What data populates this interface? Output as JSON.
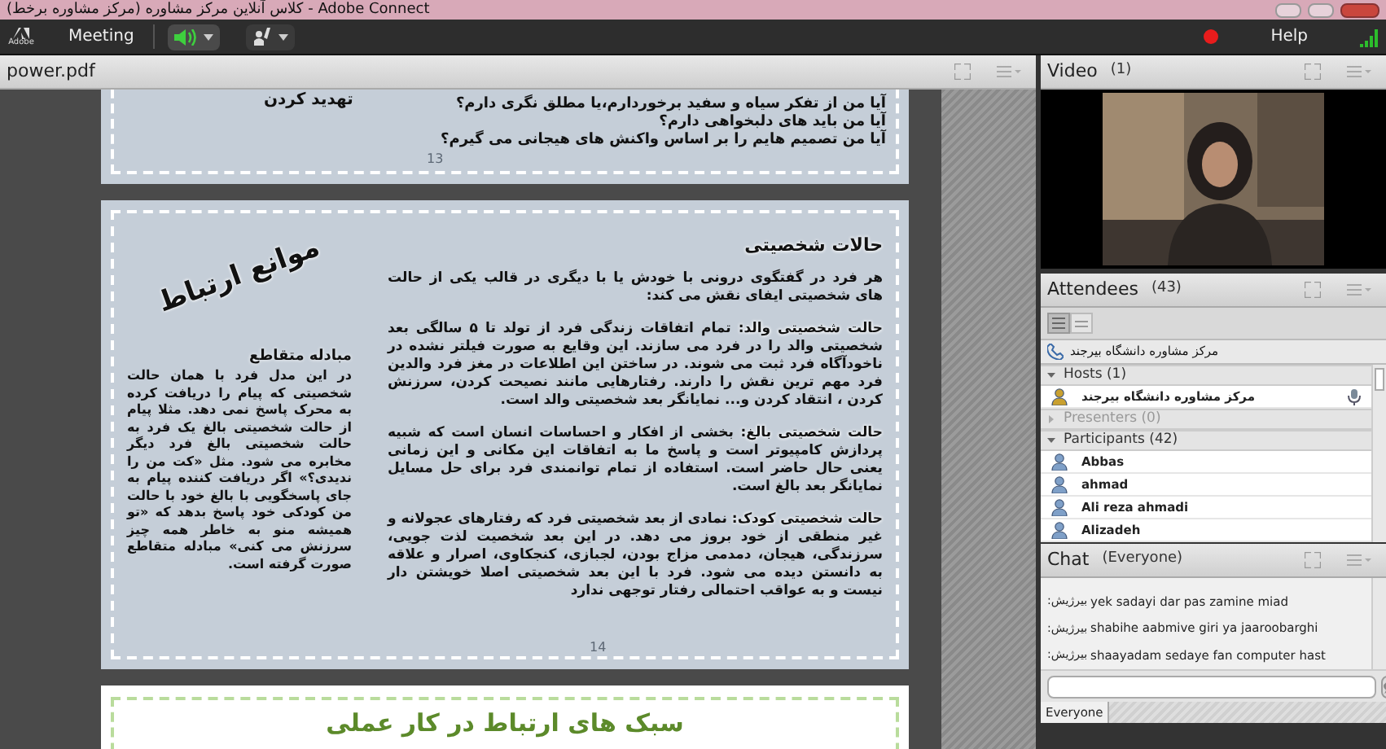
{
  "window": {
    "title": "کلاس آنلاین مرکز مشاوره (مرکز مشاوره برخط) - Adobe Connect",
    "app_logo": "Adobe"
  },
  "toolbar": {
    "menu": "Meeting",
    "audio_on": true,
    "help": "Help",
    "recording": true
  },
  "share_pod": {
    "title": "power.pdf",
    "slides": [
      {
        "kind": "questions",
        "side_label": "تهدید کردن",
        "lines": [
          "آیا من از تفکر سیاه و سفید برخوردارم،یا مطلق نگری دارم؟",
          "آیا من باید های دلبخواهی دارم؟",
          "آیا من تصمیم هایم را بر اساس واکنش های هیجانی می گیرم؟"
        ],
        "page": "13"
      },
      {
        "kind": "article",
        "title": "حالات شخصیتی",
        "intro": "هر فرد در گفتگوی درونی با خودش یا با دیگری در قالب یکی از حالت های شخصیتی ایفای نقش می کند:",
        "paragraphs": [
          "**حالت شخصیتی والد:** تمام اتفاقات زندگی فرد از تولد تا ۵ سالگی بعد شخصیتی والد را در فرد می سازند. این وقایع به صورت فیلتر نشده در ناخودآگاه فرد ثبت می شوند. در ساختن این اطلاعات در مغز فرد والدین فرد مهم ترین نقش را دارند. رفتارهایی مانند نصیحت کردن، سرزنش کردن ، انتقاد کردن و... نمایانگر بعد شخصیتی والد است.",
          "**حالت شخصیتی بالغ:** بخشی از افکار و احساسات انسان است که شبیه پردازش کامپیوتر است و پاسخ ما به اتفاقات این مکانی و این زمانی یعنی حال حاضر است. استفاده از تمام توانمندی فرد برای حل مسایل نمایانگر بعد بالغ است.",
          "**حالت شخصیتی کودک:** نمادی از بعد شخصیتی فرد که رفتارهای عجولانه و غیر منطقی از خود بروز می دهد. در این بعد شخصیت لذت جویی، سرزندگی، هیجان، دمدمی مزاج بودن، لجبازی، کنجکاوی، اصرار و علاقه به دانستن دیده می شود. فرد با این بعد شخصیتی اصلا خویشتن دار نیست و به عواقب احتمالی رفتار توجهی ندارد"
        ],
        "side_title": "موانع ارتباط",
        "side_heading": "مبادله متقاطع",
        "side_text": "در این مدل فرد با همان حالت شخصیتی که پیام را دریافت کرده به محرک پاسخ نمی دهد. مثلا پیام از حالت شخصیتی بالغ یک فرد به حالت شخصیتی بالغ فرد دیگر مخابره می شود. مثل «کت من را ندیدی؟» اگر دریافت کننده پیام به جای پاسخگویی با بالغ خود با حالت من کودکی خود پاسخ بدهد که «تو همیشه منو به خاطر همه چیز سرزنش می کنی» مبادله متقاطع صورت گرفته است.",
        "page": "14"
      },
      {
        "kind": "banner",
        "title": "سبک های ارتباط در کار عملی"
      }
    ]
  },
  "video_pod": {
    "title": "Video",
    "count": "(1)"
  },
  "attendees_pod": {
    "title": "Attendees",
    "count": "(43)",
    "me": "مرکز مشاوره دانشگاه بیرجند",
    "groups": [
      {
        "label": "Hosts (1)",
        "expanded": true,
        "members": [
          {
            "name": "مرکز مشاوره دانشگاه بیرجند",
            "kind": "host"
          }
        ]
      },
      {
        "label": "Presenters (0)",
        "expanded": false
      },
      {
        "label": "Participants (42)",
        "expanded": true,
        "members": [
          {
            "name": "Abbas",
            "kind": "participant"
          },
          {
            "name": "ahmad",
            "kind": "participant"
          },
          {
            "name": "Ali reza ahmadi",
            "kind": "participant"
          },
          {
            "name": "Alizadeh",
            "kind": "participant"
          }
        ]
      }
    ]
  },
  "chat_pod": {
    "title": "Chat",
    "scope": "(Everyone)",
    "messages": [
      {
        "sender": "بیرژیش:",
        "text": "yek sadayi dar pas zamine miad"
      },
      {
        "sender": "بیرژیش:",
        "text": "shabihe aabmive giri ya jaaroobarghi"
      },
      {
        "sender": "بیرژیش:",
        "text": "shaayadam sedaye fan computer hast"
      }
    ],
    "tab": "Everyone"
  }
}
